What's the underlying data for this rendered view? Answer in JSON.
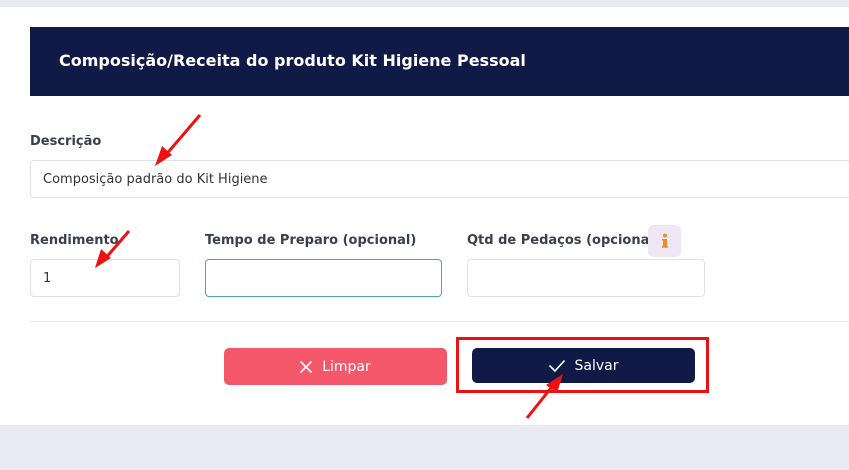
{
  "header": {
    "title": "Composição/Receita do produto Kit Higiene Pessoal"
  },
  "form": {
    "descricao": {
      "label": "Descrição",
      "value": "Composição padrão do Kit Higiene"
    },
    "rendimento": {
      "label": "Rendimento",
      "value": "1"
    },
    "tempo_preparo": {
      "label": "Tempo de Preparo (opcional)",
      "value": ""
    },
    "qtd_pedacos": {
      "label": "Qtd de Pedaços (opcional)",
      "value": "",
      "info_icon": "info-icon"
    }
  },
  "actions": {
    "clear_label": "Limpar",
    "save_label": "Salvar"
  },
  "colors": {
    "header_bg": "#111a47",
    "clear_button": "#f4566a",
    "save_button": "#111a47",
    "annotation": "#ee1111",
    "page_bg": "#e9eaf3"
  }
}
